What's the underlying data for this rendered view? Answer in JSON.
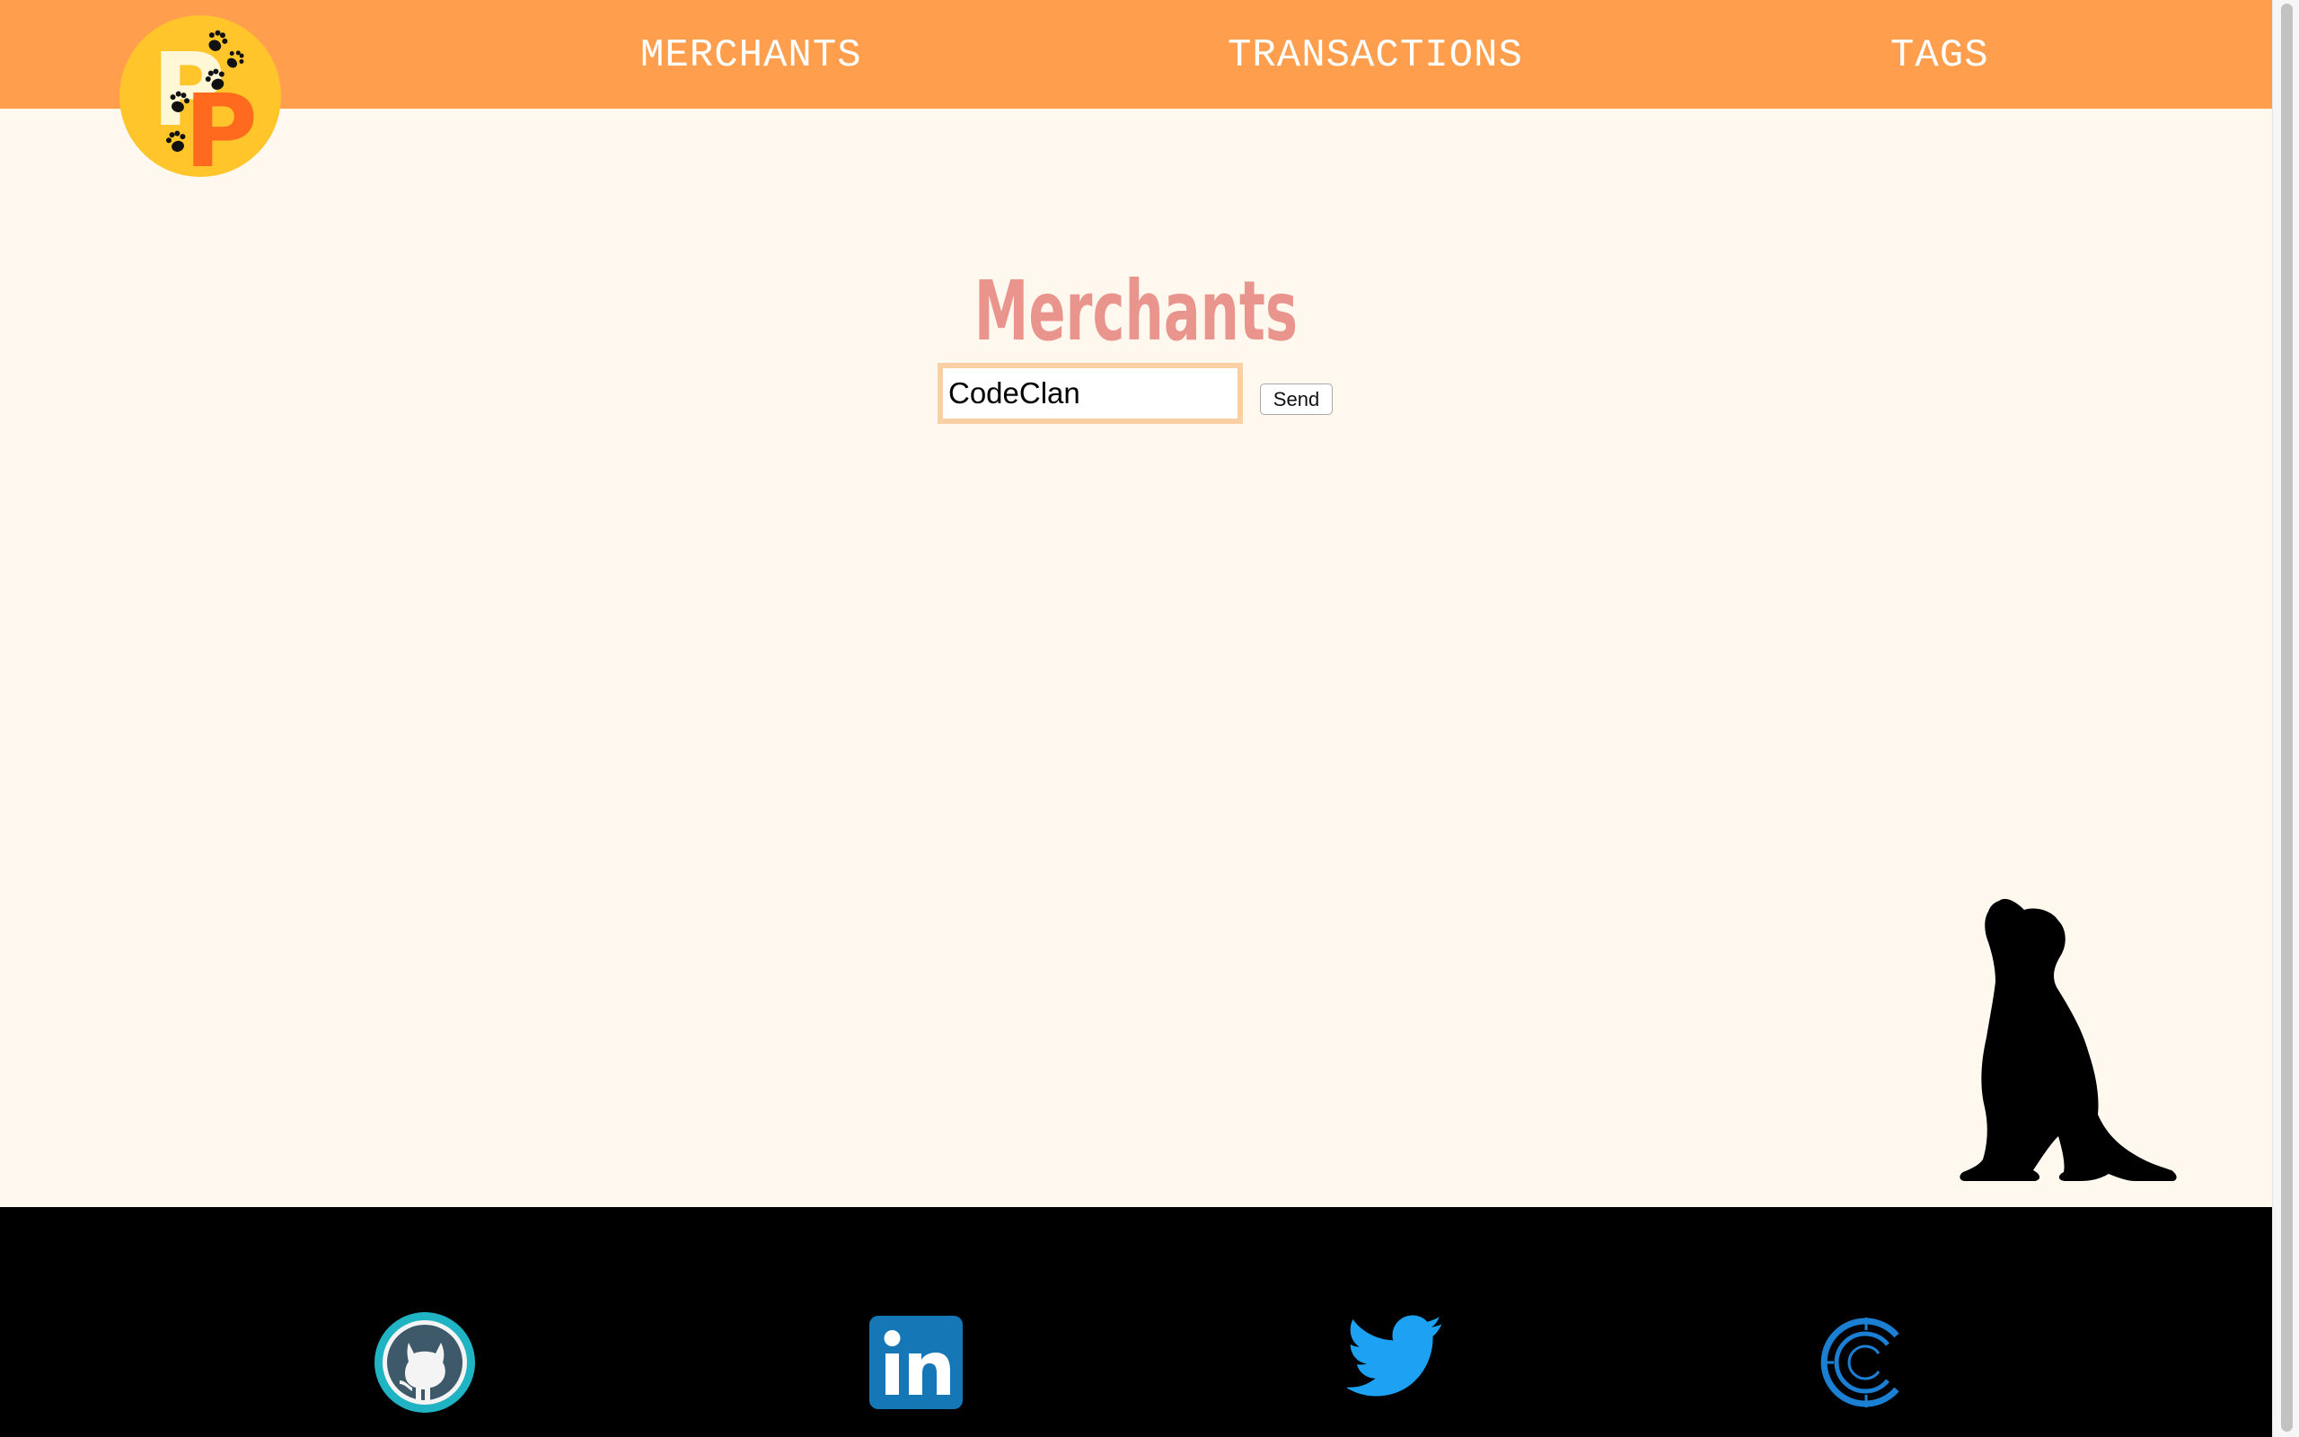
{
  "nav": {
    "merchants_label": "MERCHANTS",
    "transactions_label": "TRANSACTIONS",
    "tags_label": "TAGS"
  },
  "logo": {
    "letters": "PP"
  },
  "main": {
    "title": "Merchants",
    "search": {
      "value": "CodeClan",
      "button_label": "Send"
    }
  },
  "footer": {
    "icons": [
      "github-icon",
      "linkedin-icon",
      "twitter-icon",
      "codeclan-icon"
    ]
  },
  "colors": {
    "navbar": "#ff9e4d",
    "background": "#fff8ee",
    "title": "#e9958e",
    "input_border": "#f8d0a4",
    "footer": "#000000"
  }
}
